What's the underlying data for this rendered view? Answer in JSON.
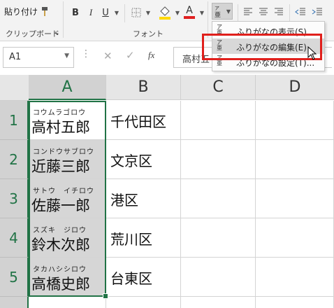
{
  "ribbon": {
    "paste_label": "貼り付け",
    "clipboard_label": "クリップボード",
    "font_group_label": "フォント",
    "bold": "B",
    "italic": "I",
    "underline": "U",
    "font_color_letter": "A",
    "font_color": "#e02020",
    "fill_color": "#ffd800"
  },
  "formula_bar": {
    "cell_ref": "A1",
    "fx": "fx",
    "content": "高村五"
  },
  "menu": {
    "items": [
      {
        "label": "ふりがなの表示(S)"
      },
      {
        "label": "ふりがなの編集(E)"
      },
      {
        "label": "ふりがなの設定(T)..."
      }
    ]
  },
  "columns": [
    "A",
    "B",
    "C",
    "D"
  ],
  "rows": [
    {
      "num": "1",
      "furigana": "コウムラゴロウ",
      "name": "高村五郎",
      "ward": "千代田区"
    },
    {
      "num": "2",
      "furigana": "コンドウサブロウ",
      "name": "近藤三郎",
      "ward": "文京区"
    },
    {
      "num": "3",
      "furigana": "サトウ　イチロウ",
      "name": "佐藤一郎",
      "ward": "港区"
    },
    {
      "num": "4",
      "furigana": "スズキ　ジロウ",
      "name": "鈴木次郎",
      "ward": "荒川区"
    },
    {
      "num": "5",
      "furigana": "タカハシシロウ",
      "name": "高橋史郎",
      "ward": "台東区"
    }
  ],
  "colors": {
    "accent": "#217346",
    "highlight_box": "#e0201c"
  }
}
